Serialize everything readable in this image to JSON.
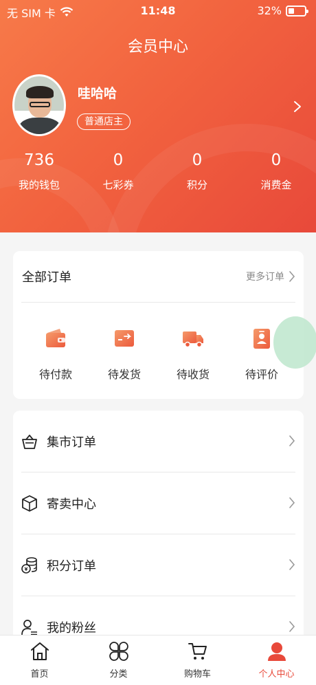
{
  "status_bar": {
    "carrier": "无 SIM 卡",
    "time": "11:48",
    "battery": "32%"
  },
  "header": {
    "title": "会员中心",
    "username": "哇哈哈",
    "level": "普通店主"
  },
  "stats": [
    {
      "value": "736",
      "label": "我的钱包"
    },
    {
      "value": "0",
      "label": "七彩券"
    },
    {
      "value": "0",
      "label": "积分"
    },
    {
      "value": "0",
      "label": "消费金"
    }
  ],
  "orders": {
    "title": "全部订单",
    "more": "更多订单",
    "items": [
      {
        "label": "待付款",
        "icon": "wallet-icon"
      },
      {
        "label": "待发货",
        "icon": "card-send-icon"
      },
      {
        "label": "待收货",
        "icon": "truck-icon"
      },
      {
        "label": "待评价",
        "icon": "review-badge-icon"
      }
    ]
  },
  "menu": [
    {
      "label": "集市订单",
      "icon": "basket-icon"
    },
    {
      "label": "寄卖中心",
      "icon": "box-icon"
    },
    {
      "label": "积分订单",
      "icon": "coins-icon"
    },
    {
      "label": "我的粉丝",
      "icon": "user-list-icon"
    }
  ],
  "tabbar": [
    {
      "label": "首页",
      "icon": "home-icon"
    },
    {
      "label": "分类",
      "icon": "category-icon"
    },
    {
      "label": "购物车",
      "icon": "cart-icon"
    },
    {
      "label": "个人中心",
      "icon": "person-icon",
      "active": true
    }
  ],
  "colors": {
    "accent": "#e8493a",
    "header_start": "#f77a49",
    "header_end": "#e8493a",
    "icon_gradient_start": "#f59a6a",
    "icon_gradient_end": "#ec5a3c"
  }
}
